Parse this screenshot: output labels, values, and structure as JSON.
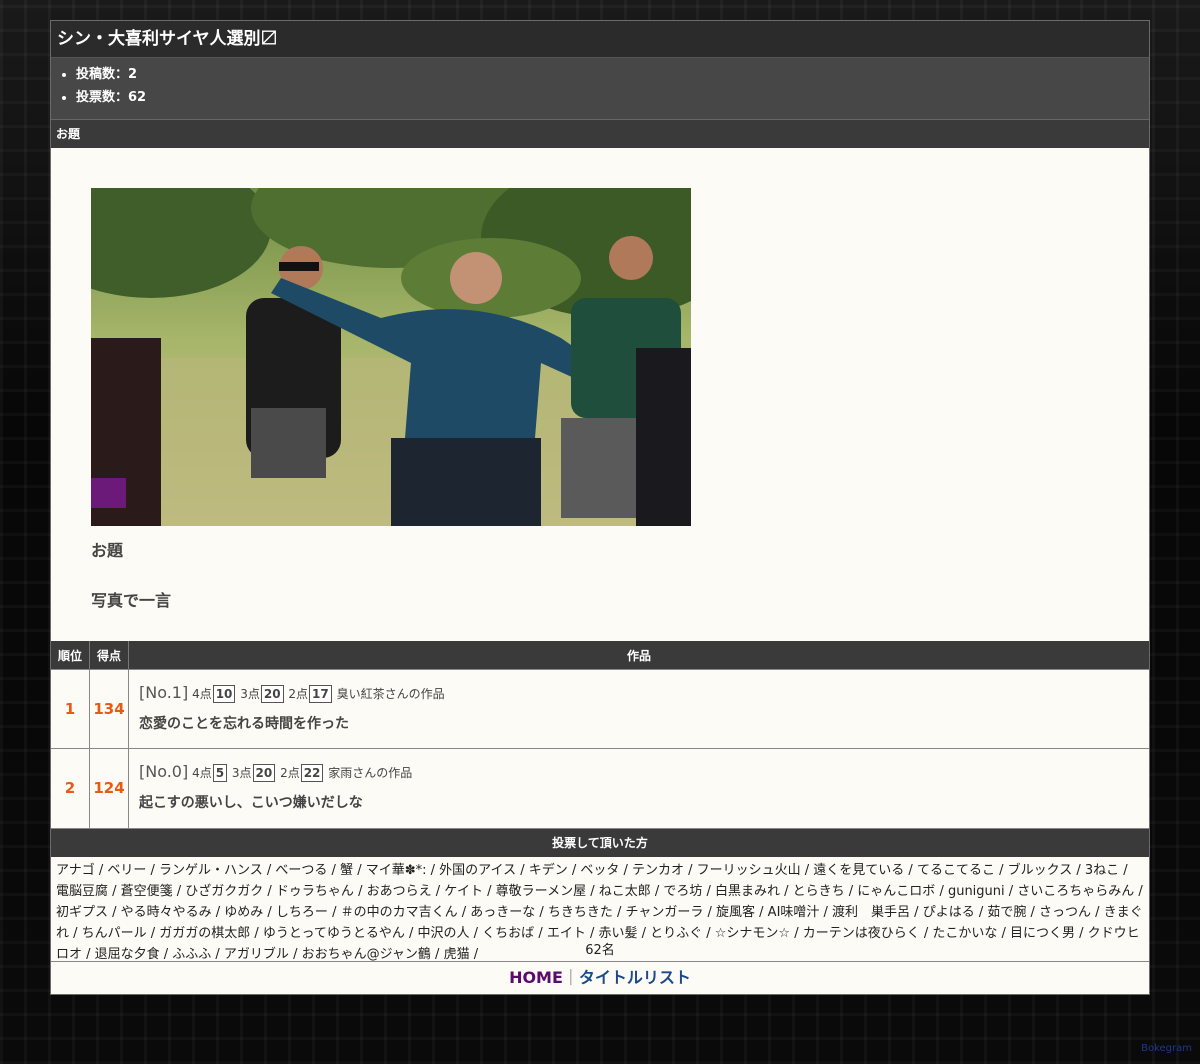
{
  "title": "シン・大喜利サイヤ人選別〼",
  "stats": [
    {
      "label": "投稿数：",
      "value": "2"
    },
    {
      "label": "投票数：",
      "value": "62"
    }
  ],
  "odai_section": {
    "header": "お題",
    "label": "お題",
    "text": "写真で一言"
  },
  "ranking": {
    "headers": {
      "rank": "順位",
      "score": "得点",
      "work": "作品"
    },
    "entries": [
      {
        "rank": "1",
        "score": "134",
        "no": "[No.1]",
        "p4_label": "4点",
        "p4": "10",
        "p3_label": "3点",
        "p3": "20",
        "p2_label": "2点",
        "p2": "17",
        "author": "臭い紅茶さんの作品",
        "text": "恋愛のことを忘れる時間を作った"
      },
      {
        "rank": "2",
        "score": "124",
        "no": "[No.0]",
        "p4_label": "4点",
        "p4": "5",
        "p3_label": "3点",
        "p3": "20",
        "p2_label": "2点",
        "p2": "22",
        "author": "家雨さんの作品",
        "text": "起こすの悪いし、こいつ嫌いだしな"
      }
    ]
  },
  "voters": {
    "header": "投票して頂いた方",
    "names": "アナゴ / ベリー / ランゲル・ハンス / べーつる / 蟹 / マイ華✽*: / 外国のアイス / キデン / ベッタ / テンカオ / フーリッシュ火山 / 遠くを見ている / てるこてるこ / ブルックス / 3ねこ / 電脳豆腐 / 蒼空便箋 / ひざガクガク / ドゥラちゃん / おあつらえ / ケイト / 尊敬ラーメン屋 / ねこ太郎 / でろ坊 / 白黒まみれ / とらきち / にゃんこロボ / guniguni / さいころちゃらみん / 初ギプス / やる時々やるみ / ゆめみ / しちろー / ＃の中のカマ吉くん / あっきーな / ちきちきた / チャンガーラ / 旋風客 / AI味噌汁 / 渡利　巣手呂 / ぴよはる / 茹で腕 / さっつん / きまぐれ / ちんパール / ガガガの棋太郎 / ゆうとってゆうとるやん / 中沢の人 / くちおば / エイト / 赤い髪 / とりふぐ / ☆シナモン☆ / カーテンは夜ひらく / たこかいな / 目につく男 / クドウヒロオ / 退屈な夕食 / ふふふ / アガリブル / おおちゃん@ジャン鶴 / 虎猫 /",
    "count": "62名"
  },
  "footer": {
    "home": "HOME",
    "separator": "｜",
    "title_list": "タイトルリスト"
  },
  "credit": "Bokegram"
}
